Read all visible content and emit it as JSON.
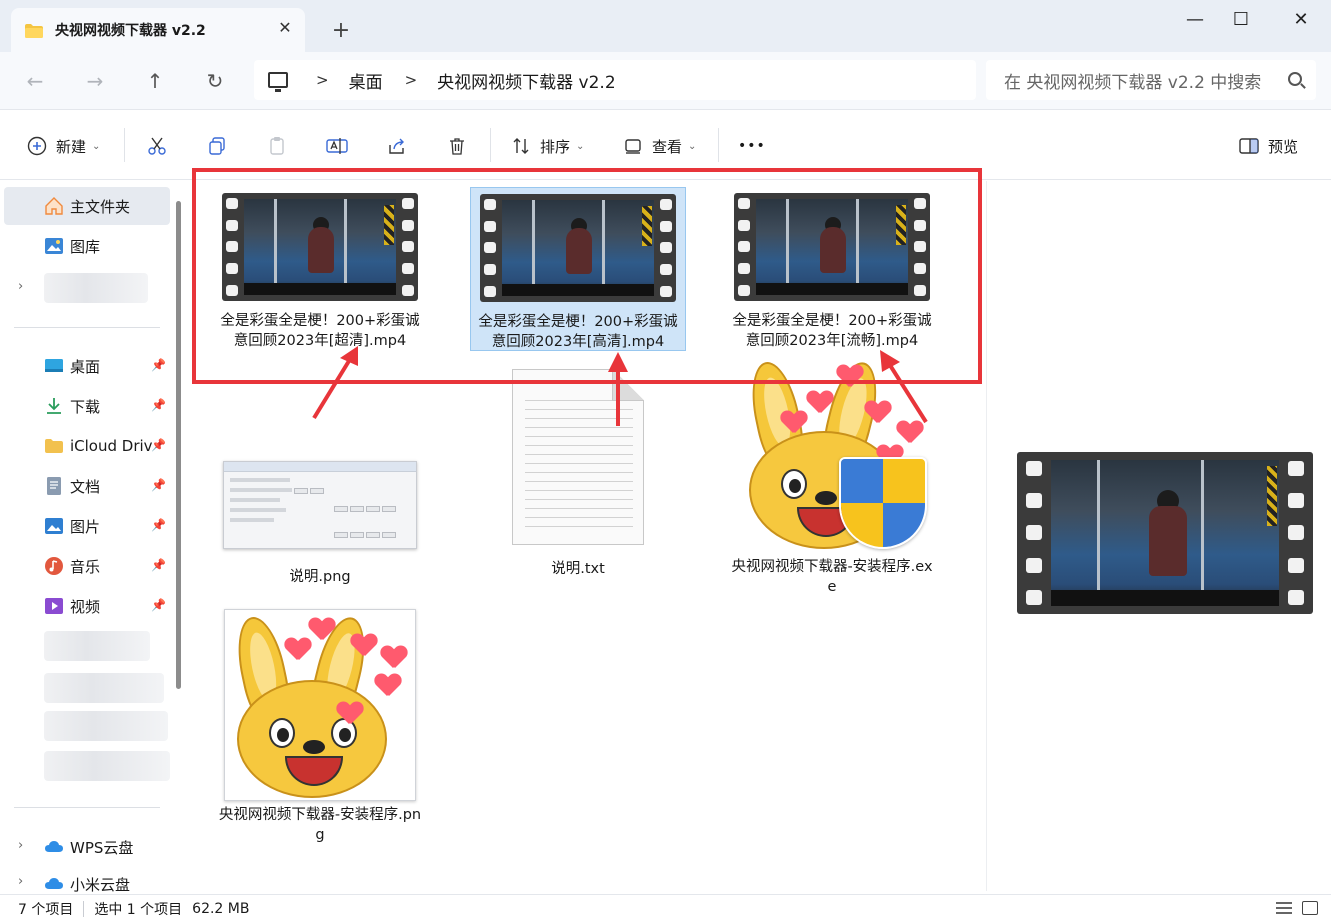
{
  "window": {
    "tab_title": "央视网视频下载器 v2.2",
    "tab_close": "✕",
    "new_tab": "+",
    "minimize": "—",
    "maximize": "☐",
    "close": "✕"
  },
  "nav": {
    "back": "←",
    "forward": "→",
    "up": "↑",
    "refresh": "↻"
  },
  "breadcrumb": [
    "桌面",
    "央视网视频下载器 v2.2"
  ],
  "breadcrumb_sep": ">",
  "search": {
    "placeholder": "在 央视网视频下载器 v2.2 中搜索"
  },
  "toolbar": {
    "new_label": "新建",
    "sort_label": "排序",
    "view_label": "查看",
    "more_label": "•••",
    "preview_label": "预览"
  },
  "sidebar": {
    "items": [
      {
        "label": "主文件夹",
        "icon": "home-icon",
        "color": "#f08a3e"
      },
      {
        "label": "图库",
        "icon": "gallery-icon",
        "color": "#3a86d6"
      },
      {
        "label": "桌面",
        "icon": "desktop-icon",
        "color": "#2ea5e0"
      },
      {
        "label": "下载",
        "icon": "download-icon",
        "color": "#2a9d5c"
      },
      {
        "label": "iCloud Driv",
        "icon": "folder-icon",
        "color": "#f2c14e"
      },
      {
        "label": "文档",
        "icon": "document-icon",
        "color": "#6b7d92"
      },
      {
        "label": "图片",
        "icon": "pictures-icon",
        "color": "#2f7fd1"
      },
      {
        "label": "音乐",
        "icon": "music-icon",
        "color": "#e2583e"
      },
      {
        "label": "视频",
        "icon": "video-icon",
        "color": "#8a4bd1"
      },
      {
        "label": "WPS云盘",
        "icon": "cloud-icon",
        "color": "#2e8de6"
      },
      {
        "label": "小米云盘",
        "icon": "cloud-icon",
        "color": "#2e8de6"
      }
    ],
    "pin": "📌",
    "expand": "›"
  },
  "files": [
    {
      "name": "全是彩蛋全是梗！200+彩蛋诚意回顾2023年[超清].mp4",
      "type": "video"
    },
    {
      "name": "全是彩蛋全是梗！200+彩蛋诚意回顾2023年[高清].mp4",
      "type": "video",
      "selected": true
    },
    {
      "name": "全是彩蛋全是梗！200+彩蛋诚意回顾2023年[流畅].mp4",
      "type": "video"
    },
    {
      "name": "说明.png",
      "type": "image"
    },
    {
      "name": "说明.txt",
      "type": "text"
    },
    {
      "name": "央视网视频下载器-安装程序.exe",
      "type": "exe"
    },
    {
      "name": "央视网视频下载器-安装程序.png",
      "type": "image"
    }
  ],
  "status": {
    "count": "7 个项目",
    "selection": "选中 1 个项目",
    "size": "62.2 MB"
  },
  "colors": {
    "highlight": "#e8353a",
    "selection_bg": "#cfe4f8"
  }
}
